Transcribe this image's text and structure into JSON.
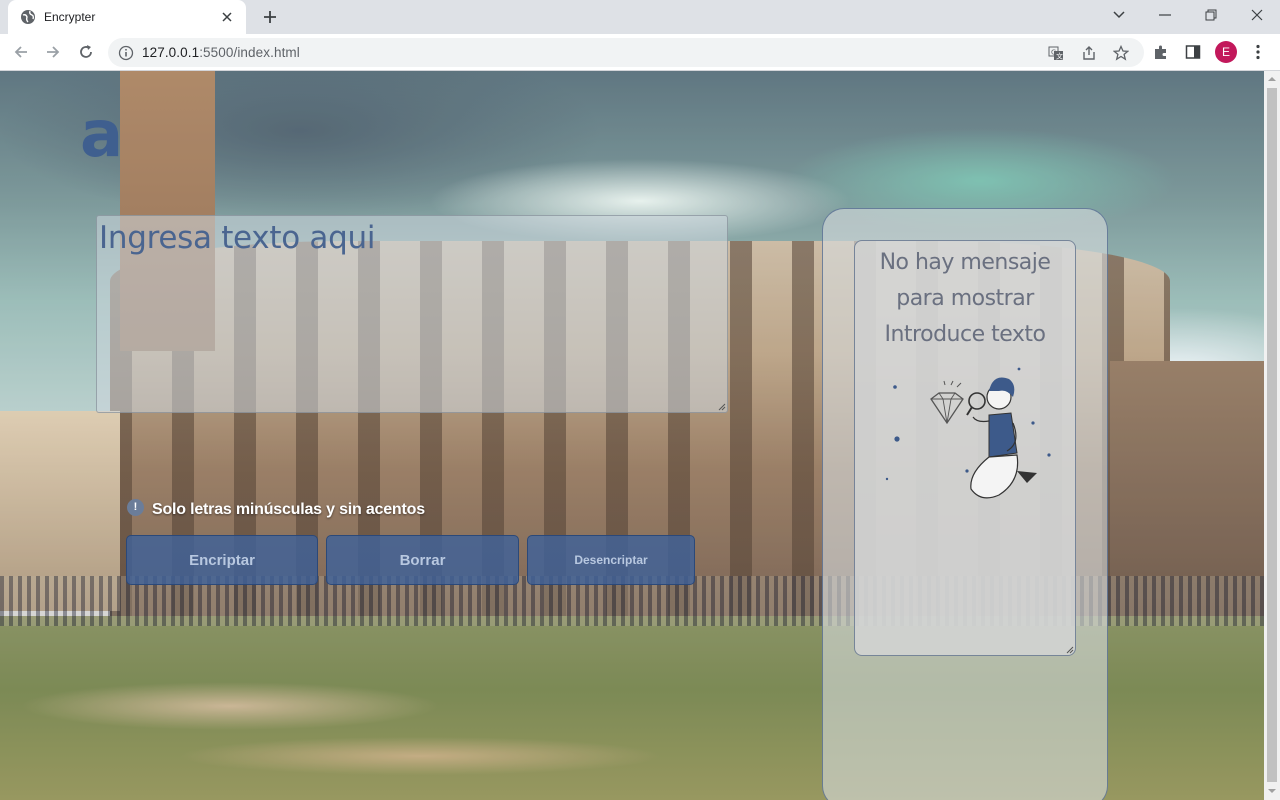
{
  "browser": {
    "tab_title": "Encrypter",
    "url_host": "127.0.0.1",
    "url_rest": ":5500/index.html",
    "avatar_letter": "E",
    "avatar_color": "#c2185b"
  },
  "app": {
    "logo": "a",
    "input_placeholder": "Ingresa texto aqui",
    "hint": "Solo letras minúsculas y sin acentos",
    "hint_icon": "!",
    "buttons": {
      "encrypt": "Encriptar",
      "clear": "Borrar",
      "decrypt": "Desencriptar"
    },
    "output_message": "No hay mensaje para mostrar Introduce texto",
    "illustration_icon": "person-with-magnifier-and-diamond-icon"
  },
  "colors": {
    "button_bg": "#406199",
    "logo": "#3f5f8f",
    "placeholder": "#4a6590"
  }
}
